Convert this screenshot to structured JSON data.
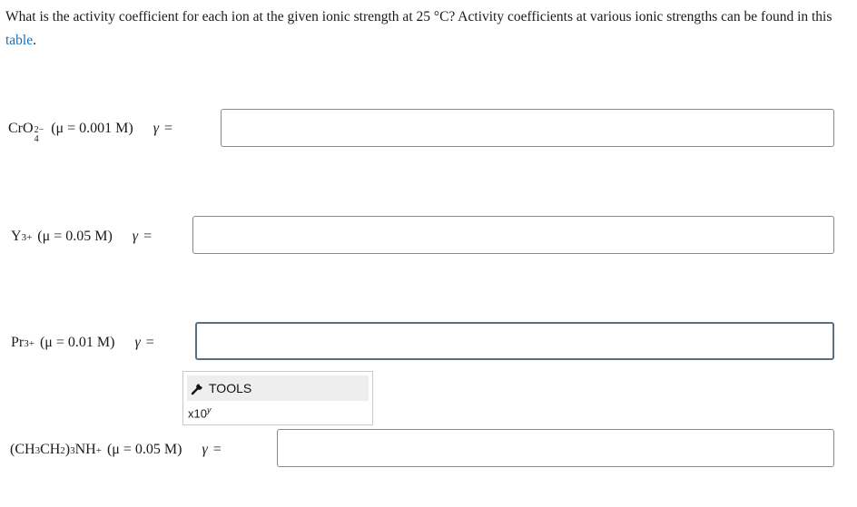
{
  "question": {
    "text": "What is the activity coefficient for each ion at the given ionic strength at 25 °C? Activity coefficients at various ionic strengths can be found in this ",
    "link": "table",
    "end": "."
  },
  "rows": [
    {
      "ion_base": "CrO",
      "ion_sub": "4",
      "ion_sup": "2−",
      "mu": "(μ = 0.001 M)",
      "gamma": "γ",
      "eq": "=",
      "value": ""
    },
    {
      "ion_base": "Y",
      "ion_sup": "3+",
      "mu": "(μ = 0.05 M)",
      "gamma": "γ",
      "eq": "=",
      "value": ""
    },
    {
      "ion_base": "Pr",
      "ion_sup": "3+",
      "mu": "(μ = 0.01 M)",
      "gamma": "γ",
      "eq": "=",
      "value": ""
    },
    {
      "ion_p1": "(CH",
      "ion_s1": "3",
      "ion_p2": "CH",
      "ion_s2": "2",
      "ion_p3": ")",
      "ion_s3": "3",
      "ion_p4": "NH",
      "ion_sup": "+",
      "mu": "(μ = 0.05 M)",
      "gamma": "γ",
      "eq": "=",
      "value": ""
    }
  ],
  "tools": {
    "label": "TOOLS",
    "icon": "wrench-icon",
    "x10_base": "x10",
    "x10_exp": "y"
  }
}
